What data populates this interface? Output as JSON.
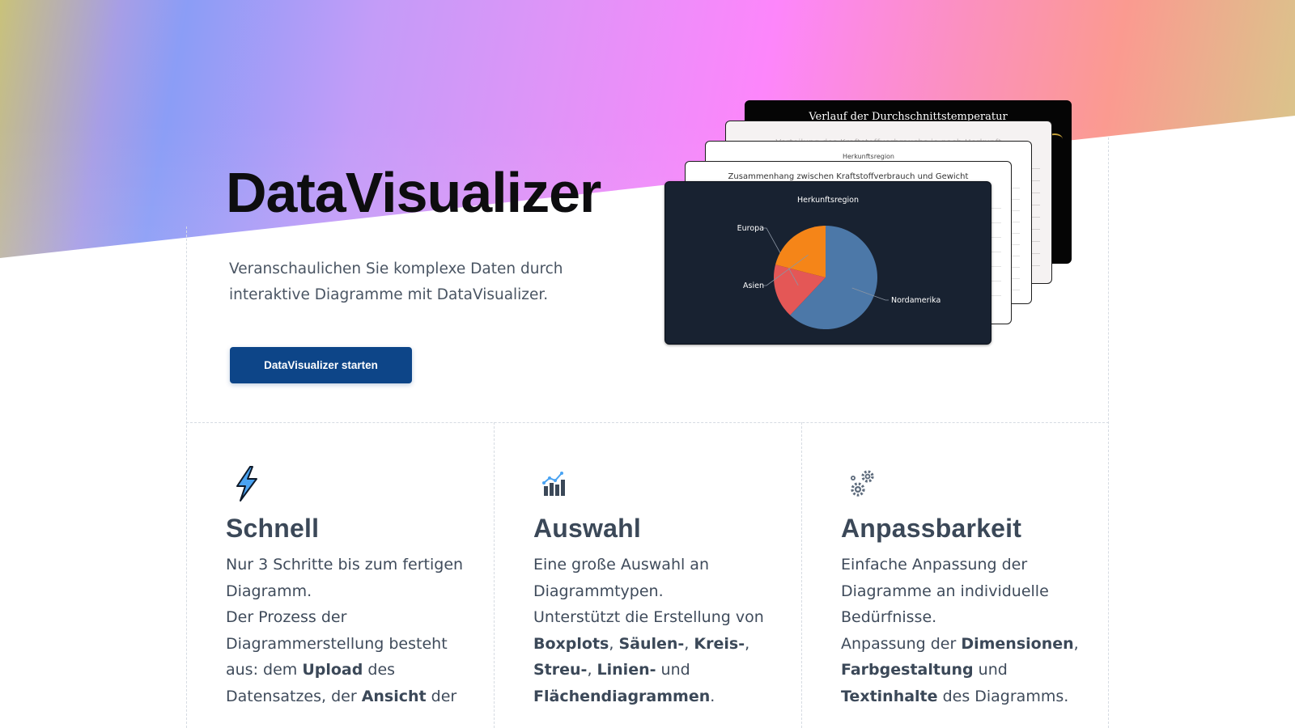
{
  "hero": {
    "title": "DataVisualizer",
    "subtitle": "Veranschaulichen Sie komplexe Daten durch interaktive Diagramme mit DataVisualizer.",
    "cta_label": "DataVisualizer starten"
  },
  "preview_cards": {
    "card5_title": "Verlauf der Durchschnittstemperatur",
    "card4_title": "Verteilung des Kraftstoffverbrauchs je nach Herkunft",
    "card3_title": "Herkunftsregion",
    "card2_title": "Zusammenhang zwischen Kraftstoffverbrauch und Gewicht"
  },
  "chart_data": {
    "type": "pie",
    "title": "Herkunftsregion",
    "labels": [
      "Nordamerika",
      "Europa",
      "Asien"
    ],
    "values": [
      62,
      17,
      21
    ],
    "colors": [
      "#4c78a8",
      "#e45756",
      "#f58518"
    ]
  },
  "features": [
    {
      "title": "Schnell",
      "icon": "lightning-icon",
      "paragraphs": [
        [
          {
            "t": "Nur 3 Schritte bis zum fertigen Diagramm.",
            "b": false
          }
        ],
        [
          {
            "t": "Der Prozess der Diagrammerstellung besteht aus: dem ",
            "b": false
          },
          {
            "t": "Upload",
            "b": true
          },
          {
            "t": " des Datensatzes, der ",
            "b": false
          },
          {
            "t": "Ansicht",
            "b": true
          },
          {
            "t": " der",
            "b": false
          }
        ]
      ]
    },
    {
      "title": "Auswahl",
      "icon": "bar-chart-icon",
      "paragraphs": [
        [
          {
            "t": "Eine große Auswahl an Diagrammtypen.",
            "b": false
          }
        ],
        [
          {
            "t": "Unterstützt die Erstellung von ",
            "b": false
          },
          {
            "t": "Boxplots",
            "b": true
          },
          {
            "t": ", ",
            "b": false
          },
          {
            "t": "Säulen-",
            "b": true
          },
          {
            "t": ", ",
            "b": false
          },
          {
            "t": "Kreis-",
            "b": true
          },
          {
            "t": ", ",
            "b": false
          },
          {
            "t": "Streu-",
            "b": true
          },
          {
            "t": ", ",
            "b": false
          },
          {
            "t": "Linien-",
            "b": true
          },
          {
            "t": " und ",
            "b": false
          },
          {
            "t": "Flächendiagrammen",
            "b": true
          },
          {
            "t": ".",
            "b": false
          }
        ]
      ]
    },
    {
      "title": "Anpassbarkeit",
      "icon": "gears-icon",
      "paragraphs": [
        [
          {
            "t": "Einfache Anpassung der Diagramme an individuelle Bedürfnisse.",
            "b": false
          }
        ],
        [
          {
            "t": "Anpassung der ",
            "b": false
          },
          {
            "t": "Dimensionen",
            "b": true
          },
          {
            "t": ", ",
            "b": false
          },
          {
            "t": "Farbgestaltung",
            "b": true
          },
          {
            "t": " und ",
            "b": false
          },
          {
            "t": "Textinhalte",
            "b": true
          },
          {
            "t": " des Diagramms.",
            "b": false
          }
        ]
      ]
    }
  ]
}
